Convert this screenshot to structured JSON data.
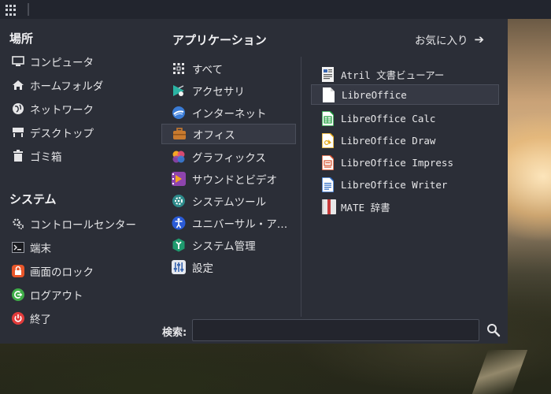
{
  "panel": {},
  "menu": {
    "places": {
      "title": "場所",
      "items": [
        {
          "label": "コンピュータ",
          "icon": "computer-icon"
        },
        {
          "label": "ホームフォルダ",
          "icon": "home-icon"
        },
        {
          "label": "ネットワーク",
          "icon": "network-icon"
        },
        {
          "label": "デスクトップ",
          "icon": "desktop-icon"
        },
        {
          "label": "ゴミ箱",
          "icon": "trash-icon"
        }
      ]
    },
    "system": {
      "title": "システム",
      "items": [
        {
          "label": "コントロールセンター",
          "icon": "control-center-icon"
        },
        {
          "label": "端末",
          "icon": "terminal-icon"
        },
        {
          "label": "画面のロック",
          "icon": "lock-icon"
        },
        {
          "label": "ログアウト",
          "icon": "logout-icon"
        },
        {
          "label": "終了",
          "icon": "power-icon"
        }
      ]
    },
    "applications": {
      "title": "アプリケーション",
      "favorites_label": "お気に入り",
      "categories": [
        {
          "label": "すべて",
          "icon": "all-apps-icon",
          "color": "#e6e6e8"
        },
        {
          "label": "アクセサリ",
          "icon": "accessories-icon",
          "color": "#2bb3a3"
        },
        {
          "label": "インターネット",
          "icon": "internet-icon",
          "color": "#3a7bd5"
        },
        {
          "label": "オフィス",
          "icon": "office-icon",
          "color": "#c87a2e"
        },
        {
          "label": "グラフィックス",
          "icon": "graphics-icon",
          "color": "#e94e77"
        },
        {
          "label": "サウンドとビデオ",
          "icon": "sound-video-icon",
          "color": "#8e44ad"
        },
        {
          "label": "システムツール",
          "icon": "system-tools-icon",
          "color": "#2c8a8a"
        },
        {
          "label": "ユニバーサル・ア…",
          "icon": "universal-access-icon",
          "color": "#2a5bd7"
        },
        {
          "label": "システム管理",
          "icon": "administration-icon",
          "color": "#1f9a6e"
        },
        {
          "label": "設定",
          "icon": "settings-icon",
          "color": "#7a8ca8"
        }
      ],
      "selected_category": "オフィス",
      "apps": [
        {
          "label": "Atril 文書ビューアー",
          "icon": "atril-icon",
          "color": "#3a66b0"
        },
        {
          "label": "LibreOffice",
          "icon": "libreoffice-icon",
          "color": "#ffffff"
        },
        {
          "label": "LibreOffice Calc",
          "icon": "libreoffice-calc-icon",
          "color": "#1e9e3e"
        },
        {
          "label": "LibreOffice Draw",
          "icon": "libreoffice-draw-icon",
          "color": "#e6a817"
        },
        {
          "label": "LibreOffice Impress",
          "icon": "libreoffice-impress-icon",
          "color": "#d9502c"
        },
        {
          "label": "LibreOffice Writer",
          "icon": "libreoffice-writer-icon",
          "color": "#2a6ac6"
        },
        {
          "label": "MATE 辞書",
          "icon": "dictionary-icon",
          "color": "#c83c3c"
        }
      ],
      "selected_app": "LibreOffice"
    },
    "search": {
      "label": "検索:",
      "value": "",
      "placeholder": ""
    }
  }
}
